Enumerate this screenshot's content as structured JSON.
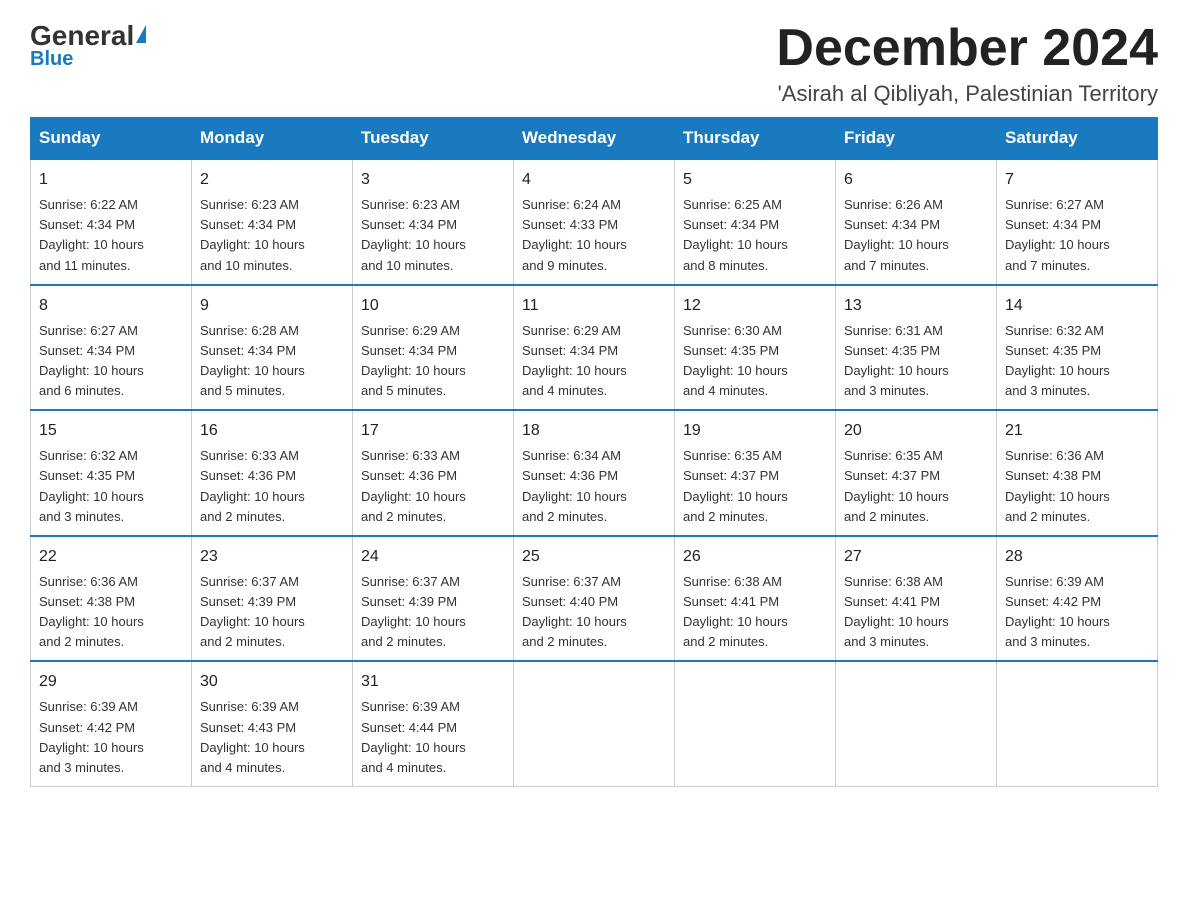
{
  "logo": {
    "general": "General",
    "blue": "Blue"
  },
  "header": {
    "title": "December 2024",
    "subtitle": "'Asirah al Qibliyah, Palestinian Territory"
  },
  "weekdays": [
    "Sunday",
    "Monday",
    "Tuesday",
    "Wednesday",
    "Thursday",
    "Friday",
    "Saturday"
  ],
  "weeks": [
    [
      {
        "day": "1",
        "sunrise": "6:22 AM",
        "sunset": "4:34 PM",
        "daylight": "10 hours and 11 minutes."
      },
      {
        "day": "2",
        "sunrise": "6:23 AM",
        "sunset": "4:34 PM",
        "daylight": "10 hours and 10 minutes."
      },
      {
        "day": "3",
        "sunrise": "6:23 AM",
        "sunset": "4:34 PM",
        "daylight": "10 hours and 10 minutes."
      },
      {
        "day": "4",
        "sunrise": "6:24 AM",
        "sunset": "4:33 PM",
        "daylight": "10 hours and 9 minutes."
      },
      {
        "day": "5",
        "sunrise": "6:25 AM",
        "sunset": "4:34 PM",
        "daylight": "10 hours and 8 minutes."
      },
      {
        "day": "6",
        "sunrise": "6:26 AM",
        "sunset": "4:34 PM",
        "daylight": "10 hours and 7 minutes."
      },
      {
        "day": "7",
        "sunrise": "6:27 AM",
        "sunset": "4:34 PM",
        "daylight": "10 hours and 7 minutes."
      }
    ],
    [
      {
        "day": "8",
        "sunrise": "6:27 AM",
        "sunset": "4:34 PM",
        "daylight": "10 hours and 6 minutes."
      },
      {
        "day": "9",
        "sunrise": "6:28 AM",
        "sunset": "4:34 PM",
        "daylight": "10 hours and 5 minutes."
      },
      {
        "day": "10",
        "sunrise": "6:29 AM",
        "sunset": "4:34 PM",
        "daylight": "10 hours and 5 minutes."
      },
      {
        "day": "11",
        "sunrise": "6:29 AM",
        "sunset": "4:34 PM",
        "daylight": "10 hours and 4 minutes."
      },
      {
        "day": "12",
        "sunrise": "6:30 AM",
        "sunset": "4:35 PM",
        "daylight": "10 hours and 4 minutes."
      },
      {
        "day": "13",
        "sunrise": "6:31 AM",
        "sunset": "4:35 PM",
        "daylight": "10 hours and 3 minutes."
      },
      {
        "day": "14",
        "sunrise": "6:32 AM",
        "sunset": "4:35 PM",
        "daylight": "10 hours and 3 minutes."
      }
    ],
    [
      {
        "day": "15",
        "sunrise": "6:32 AM",
        "sunset": "4:35 PM",
        "daylight": "10 hours and 3 minutes."
      },
      {
        "day": "16",
        "sunrise": "6:33 AM",
        "sunset": "4:36 PM",
        "daylight": "10 hours and 2 minutes."
      },
      {
        "day": "17",
        "sunrise": "6:33 AM",
        "sunset": "4:36 PM",
        "daylight": "10 hours and 2 minutes."
      },
      {
        "day": "18",
        "sunrise": "6:34 AM",
        "sunset": "4:36 PM",
        "daylight": "10 hours and 2 minutes."
      },
      {
        "day": "19",
        "sunrise": "6:35 AM",
        "sunset": "4:37 PM",
        "daylight": "10 hours and 2 minutes."
      },
      {
        "day": "20",
        "sunrise": "6:35 AM",
        "sunset": "4:37 PM",
        "daylight": "10 hours and 2 minutes."
      },
      {
        "day": "21",
        "sunrise": "6:36 AM",
        "sunset": "4:38 PM",
        "daylight": "10 hours and 2 minutes."
      }
    ],
    [
      {
        "day": "22",
        "sunrise": "6:36 AM",
        "sunset": "4:38 PM",
        "daylight": "10 hours and 2 minutes."
      },
      {
        "day": "23",
        "sunrise": "6:37 AM",
        "sunset": "4:39 PM",
        "daylight": "10 hours and 2 minutes."
      },
      {
        "day": "24",
        "sunrise": "6:37 AM",
        "sunset": "4:39 PM",
        "daylight": "10 hours and 2 minutes."
      },
      {
        "day": "25",
        "sunrise": "6:37 AM",
        "sunset": "4:40 PM",
        "daylight": "10 hours and 2 minutes."
      },
      {
        "day": "26",
        "sunrise": "6:38 AM",
        "sunset": "4:41 PM",
        "daylight": "10 hours and 2 minutes."
      },
      {
        "day": "27",
        "sunrise": "6:38 AM",
        "sunset": "4:41 PM",
        "daylight": "10 hours and 3 minutes."
      },
      {
        "day": "28",
        "sunrise": "6:39 AM",
        "sunset": "4:42 PM",
        "daylight": "10 hours and 3 minutes."
      }
    ],
    [
      {
        "day": "29",
        "sunrise": "6:39 AM",
        "sunset": "4:42 PM",
        "daylight": "10 hours and 3 minutes."
      },
      {
        "day": "30",
        "sunrise": "6:39 AM",
        "sunset": "4:43 PM",
        "daylight": "10 hours and 4 minutes."
      },
      {
        "day": "31",
        "sunrise": "6:39 AM",
        "sunset": "4:44 PM",
        "daylight": "10 hours and 4 minutes."
      },
      null,
      null,
      null,
      null
    ]
  ],
  "labels": {
    "sunrise": "Sunrise:",
    "sunset": "Sunset:",
    "daylight": "Daylight:"
  }
}
